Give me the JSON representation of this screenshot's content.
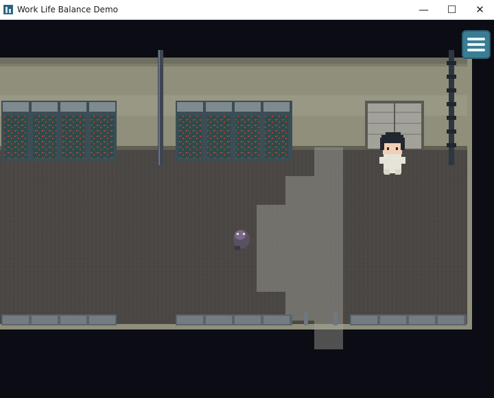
{
  "window": {
    "title": "Work Life Balance Demo",
    "icon": "app-icon",
    "controls": {
      "minimize": "—",
      "maximize": "☐",
      "close": "✕"
    }
  },
  "game": {
    "menu_button_icon": "hamburger-menu-icon",
    "colors": {
      "background": "#0c0c14",
      "wall": "#8f8f7b",
      "floor": "#4a4744",
      "highlight": "#a3a39b",
      "menu_button": "#3a7d93"
    }
  }
}
